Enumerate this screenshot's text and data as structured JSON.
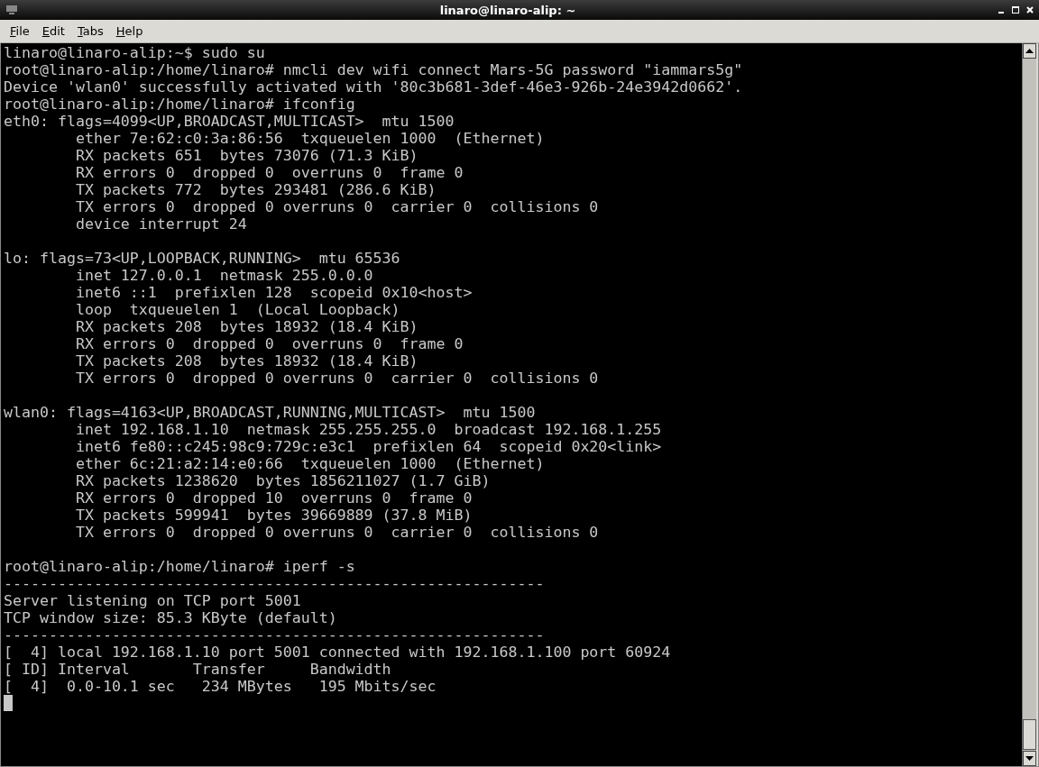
{
  "window": {
    "title": "linaro@linaro-alip: ~"
  },
  "menu": [
    {
      "mnemonic": "F",
      "rest": "ile"
    },
    {
      "mnemonic": "E",
      "rest": "dit"
    },
    {
      "mnemonic": "T",
      "rest": "abs"
    },
    {
      "mnemonic": "H",
      "rest": "elp"
    }
  ],
  "terminal": {
    "blocks": [
      [
        "linaro@linaro-alip:~$ sudo su",
        "root@linaro-alip:/home/linaro# nmcli dev wifi connect Mars-5G password \"iammars5g\"",
        "Device 'wlan0' successfully activated with '80c3b681-3def-46e3-926b-24e3942d0662'.",
        "root@linaro-alip:/home/linaro# ifconfig",
        "eth0: flags=4099<UP,BROADCAST,MULTICAST>  mtu 1500",
        "        ether 7e:62:c0:3a:86:56  txqueuelen 1000  (Ethernet)",
        "        RX packets 651  bytes 73076 (71.3 KiB)",
        "        RX errors 0  dropped 0  overruns 0  frame 0",
        "        TX packets 772  bytes 293481 (286.6 KiB)",
        "        TX errors 0  dropped 0 overruns 0  carrier 0  collisions 0",
        "        device interrupt 24"
      ],
      [
        "lo: flags=73<UP,LOOPBACK,RUNNING>  mtu 65536",
        "        inet 127.0.0.1  netmask 255.0.0.0",
        "        inet6 ::1  prefixlen 128  scopeid 0x10<host>",
        "        loop  txqueuelen 1  (Local Loopback)",
        "        RX packets 208  bytes 18932 (18.4 KiB)",
        "        RX errors 0  dropped 0  overruns 0  frame 0",
        "        TX packets 208  bytes 18932 (18.4 KiB)",
        "        TX errors 0  dropped 0 overruns 0  carrier 0  collisions 0"
      ],
      [
        "wlan0: flags=4163<UP,BROADCAST,RUNNING,MULTICAST>  mtu 1500",
        "        inet 192.168.1.10  netmask 255.255.255.0  broadcast 192.168.1.255",
        "        inet6 fe80::c245:98c9:729c:e3c1  prefixlen 64  scopeid 0x20<link>",
        "        ether 6c:21:a2:14:e0:66  txqueuelen 1000  (Ethernet)",
        "        RX packets 1238620  bytes 1856211027 (1.7 GiB)",
        "        RX errors 0  dropped 10  overruns 0  frame 0",
        "        TX packets 599941  bytes 39669889 (37.8 MiB)",
        "        TX errors 0  dropped 0 overruns 0  carrier 0  collisions 0"
      ],
      [
        "root@linaro-alip:/home/linaro# iperf -s",
        "------------------------------------------------------------",
        "Server listening on TCP port 5001",
        "TCP window size: 85.3 KByte (default)",
        "------------------------------------------------------------",
        "[  4] local 192.168.1.10 port 5001 connected with 192.168.1.100 port 60924",
        "[ ID] Interval       Transfer     Bandwidth",
        "[  4]  0.0-10.1 sec   234 MBytes   195 Mbits/sec"
      ]
    ],
    "cursor": {
      "visible": true
    }
  }
}
